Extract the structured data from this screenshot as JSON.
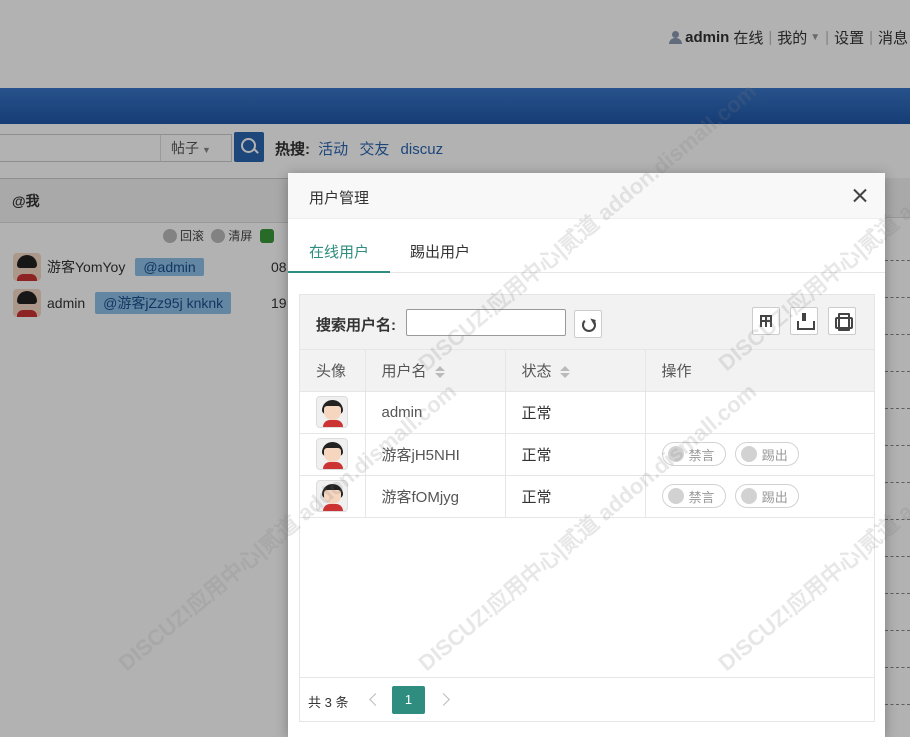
{
  "userbar": {
    "username": "admin",
    "online": "在线",
    "mine": "我的",
    "settings": "设置",
    "messages": "消息"
  },
  "search": {
    "type": "帖子",
    "hot_label": "热搜:",
    "hot_terms": [
      "活动",
      "交友",
      "discuz"
    ]
  },
  "at_panel": {
    "title": "@我",
    "tools": [
      "回滚",
      "清屏"
    ],
    "messages": [
      {
        "user": "游客YomYoy",
        "mention": "@admin",
        "time": "08"
      },
      {
        "user": "admin",
        "mention": "@游客jZz95j knknk",
        "time": "19"
      }
    ]
  },
  "dialog": {
    "title": "用户管理",
    "tabs": [
      "在线用户",
      "踢出用户"
    ],
    "search_label": "搜索用户名:",
    "search_value": "",
    "columns": [
      "头像",
      "用户名",
      "状态",
      "操作"
    ],
    "rows": [
      {
        "username": "admin",
        "status": "正常",
        "actions": []
      },
      {
        "username": "游客jH5NHI",
        "status": "正常",
        "actions": [
          "禁言",
          "踢出"
        ]
      },
      {
        "username": "游客fOMjyg",
        "status": "正常",
        "actions": [
          "禁言",
          "踢出"
        ]
      }
    ],
    "pager": {
      "total": "共 3 条",
      "current": "1"
    }
  },
  "watermark": "DISCUZ!应用中心|贰道 addon.dismall.com",
  "colors": {
    "accent": "#2e8d7f",
    "nav": "#2a65b0",
    "tag": "#8fc0ea"
  }
}
